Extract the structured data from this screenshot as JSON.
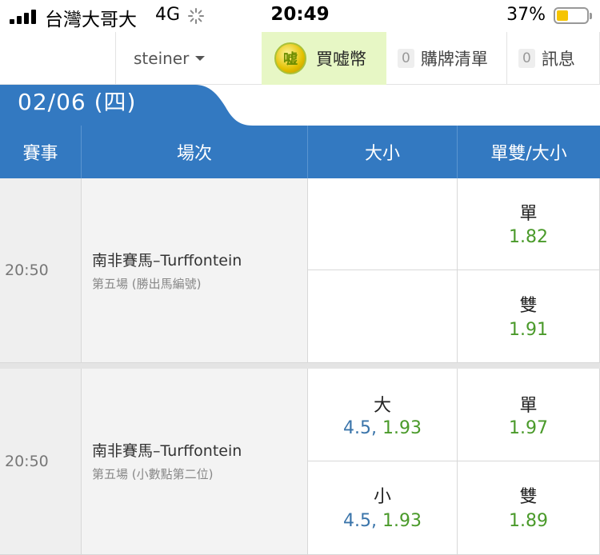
{
  "status_bar": {
    "carrier": "台灣大哥大",
    "network": "4G",
    "time": "20:49",
    "battery": "37%",
    "battery_color": "#f5c400"
  },
  "nav": {
    "username": "steiner",
    "buy_label": "買嘘幣",
    "coin_glyph": "嘘",
    "list_count": "0",
    "list_label": "購牌清單",
    "msg_count": "0",
    "msg_label": "訊息"
  },
  "date": "02/06 (四)",
  "columns": [
    "賽事",
    "場次",
    "大小",
    "單雙/大小"
  ],
  "events": [
    {
      "time": "20:50",
      "race": "南非賽馬–Turffontein",
      "sub": "第五場 (勝出馬編號)",
      "bets": [
        {
          "label": "單",
          "odds": "1.82"
        },
        {
          "label": "雙",
          "odds": "1.91"
        }
      ]
    },
    {
      "time": "20:50",
      "race": "南非賽馬–Turffontein",
      "sub": "第五場 (小數點第二位)",
      "size_bets": [
        {
          "label": "大",
          "line": "4.5,",
          "odds": "1.93"
        },
        {
          "label": "小",
          "line": "4.5,",
          "odds": "1.93"
        }
      ],
      "bets": [
        {
          "label": "單",
          "odds": "1.97"
        },
        {
          "label": "雙",
          "odds": "1.89"
        }
      ]
    }
  ],
  "colors": {
    "primary": "#3379c1",
    "odds_green": "#4a9a2a",
    "line_blue": "#3a74aa",
    "buy_bg": "#e7f7c5"
  }
}
